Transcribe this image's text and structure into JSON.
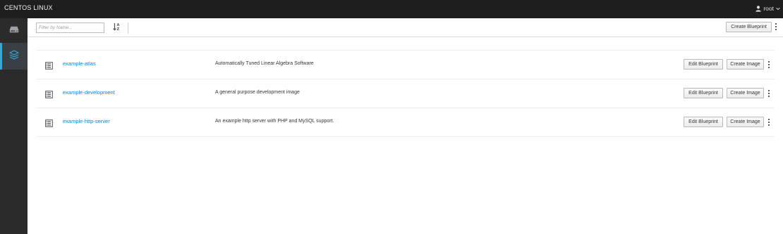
{
  "masthead": {
    "brand": "CENTOS LINUX",
    "user": "root"
  },
  "sidebar": {
    "items": [
      {
        "name": "systems",
        "icon": "hard-drive-icon",
        "active": false
      },
      {
        "name": "blueprints",
        "icon": "layers-icon",
        "active": true
      }
    ]
  },
  "toolbar": {
    "filter_placeholder": "Filter by Name...",
    "filter_value": "",
    "sort_icon": "sort-alpha-asc-icon",
    "create_blueprint_label": "Create Blueprint"
  },
  "blueprints": [
    {
      "name": "example-atlas",
      "description": "Automatically Tuned Linear Algebra Software",
      "edit_label": "Edit Blueprint",
      "create_image_label": "Create Image"
    },
    {
      "name": "example-development",
      "description": "A general purpose development image",
      "edit_label": "Edit Blueprint",
      "create_image_label": "Create Image"
    },
    {
      "name": "example-http-server",
      "description": "An example http server with PHP and MySQL support.",
      "edit_label": "Edit Blueprint",
      "create_image_label": "Create Image"
    }
  ],
  "colors": {
    "masthead": "#1e1e1e",
    "sidebar": "#2b2b2b",
    "sidebar_active": "#393f44",
    "accent": "#39a5dc",
    "link": "#0088ce"
  }
}
